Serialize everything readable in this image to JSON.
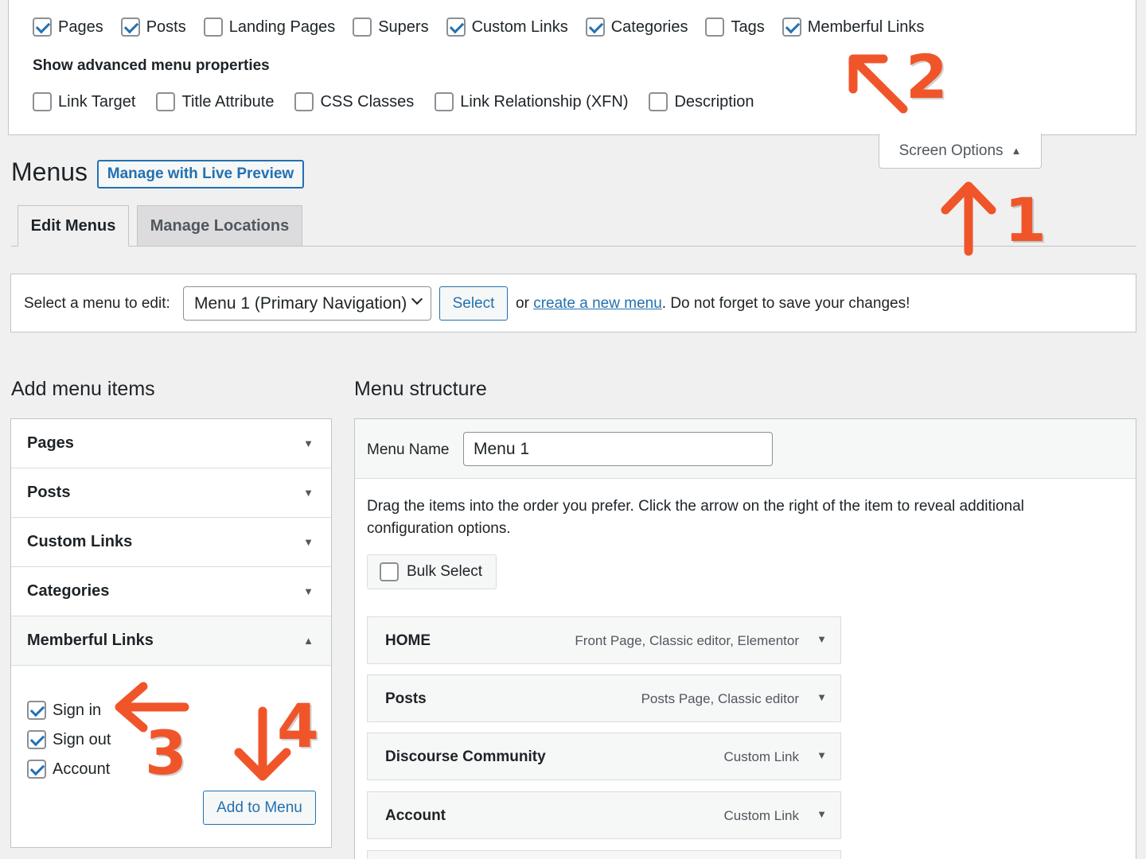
{
  "screen_options": {
    "post_types": [
      {
        "label": "Pages",
        "checked": true
      },
      {
        "label": "Posts",
        "checked": true
      },
      {
        "label": "Landing Pages",
        "checked": false
      },
      {
        "label": "Supers",
        "checked": false
      },
      {
        "label": "Custom Links",
        "checked": true
      },
      {
        "label": "Categories",
        "checked": true
      },
      {
        "label": "Tags",
        "checked": false
      },
      {
        "label": "Memberful Links",
        "checked": true
      }
    ],
    "advanced_heading": "Show advanced menu properties",
    "advanced": [
      {
        "label": "Link Target",
        "checked": false
      },
      {
        "label": "Title Attribute",
        "checked": false
      },
      {
        "label": "CSS Classes",
        "checked": false
      },
      {
        "label": "Link Relationship (XFN)",
        "checked": false
      },
      {
        "label": "Description",
        "checked": false
      }
    ],
    "tab_label": "Screen Options"
  },
  "header": {
    "title": "Menus",
    "live_preview_label": "Manage with Live Preview"
  },
  "tabs": [
    {
      "label": "Edit Menus",
      "active": true
    },
    {
      "label": "Manage Locations",
      "active": false
    }
  ],
  "select_bar": {
    "label": "Select a menu to edit:",
    "selected_menu": "Menu 1 (Primary Navigation)",
    "select_button": "Select",
    "or": "or",
    "create_link": "create a new menu",
    "note": ". Do not forget to save your changes!"
  },
  "add_items": {
    "heading": "Add menu items",
    "sections": [
      {
        "label": "Pages",
        "open": false
      },
      {
        "label": "Posts",
        "open": false
      },
      {
        "label": "Custom Links",
        "open": false
      },
      {
        "label": "Categories",
        "open": false
      },
      {
        "label": "Memberful Links",
        "open": true
      }
    ],
    "memberful_links": [
      {
        "label": "Sign in",
        "checked": true
      },
      {
        "label": "Sign out",
        "checked": true
      },
      {
        "label": "Account",
        "checked": true
      }
    ],
    "add_button": "Add to Menu"
  },
  "structure": {
    "heading": "Menu structure",
    "menu_name_label": "Menu Name",
    "menu_name_value": "Menu 1",
    "instructions": "Drag the items into the order you prefer. Click the arrow on the right of the item to reveal additional configuration options.",
    "bulk_select": "Bulk Select",
    "items": [
      {
        "title": "HOME",
        "type": "Front Page, Classic editor, Elementor"
      },
      {
        "title": "Posts",
        "type": "Posts Page, Classic editor"
      },
      {
        "title": "Discourse Community",
        "type": "Custom Link"
      },
      {
        "title": "Account",
        "type": "Custom Link"
      }
    ]
  },
  "annotations": [
    "1",
    "2",
    "3",
    "4"
  ],
  "colors": {
    "accent": "#2271b1",
    "annotation": "#f0552a",
    "background": "#f0f0f1"
  }
}
